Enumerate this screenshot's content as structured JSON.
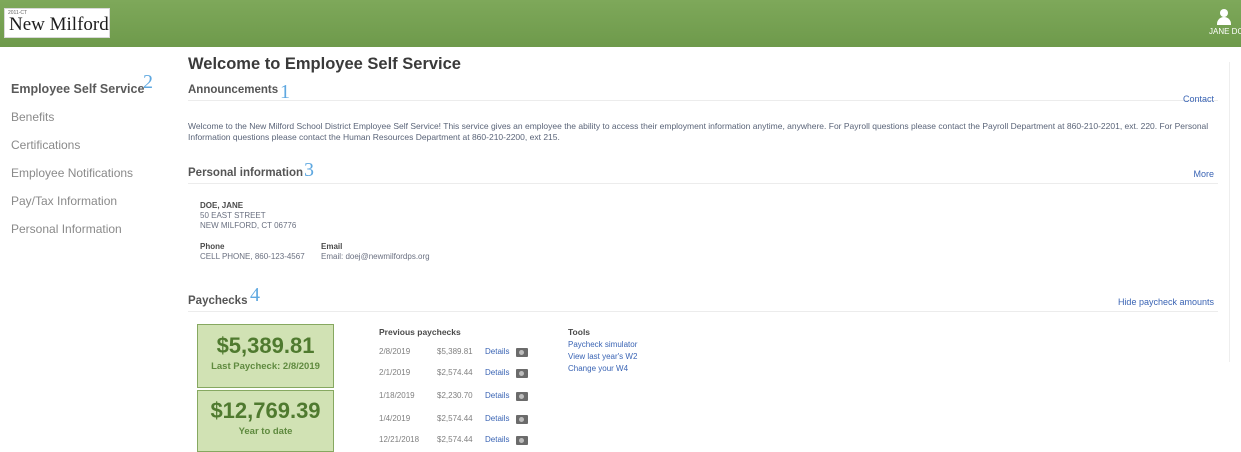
{
  "header": {
    "logo_small": "2011-CT",
    "logo_text": "New Milford",
    "user_name": "JANE DO"
  },
  "sidebar": {
    "items": [
      {
        "label": "Employee Self Service",
        "active": true
      },
      {
        "label": "Benefits"
      },
      {
        "label": "Certifications"
      },
      {
        "label": "Employee Notifications"
      },
      {
        "label": "Pay/Tax Information"
      },
      {
        "label": "Personal Information"
      }
    ]
  },
  "annotations": {
    "a1": "1",
    "a2": "2",
    "a3": "3",
    "a4": "4"
  },
  "main": {
    "title": "Welcome to Employee Self Service",
    "announcements": {
      "title": "Announcements",
      "link": "Contact",
      "text": "Welcome to the New Milford School District Employee Self Service! This service gives an employee the ability to access their employment information anytime, anywhere. For Payroll questions please contact the Payroll Department at 860-210-2201, ext. 220. For Personal Information questions please contact the Human Resources Department at 860-210-2200, ext 215."
    },
    "personal": {
      "title": "Personal information",
      "link": "More",
      "name": "DOE, JANE",
      "address1": "50 EAST STREET",
      "address2": "NEW MILFORD, CT 06776",
      "phone_label": "Phone",
      "phone": "CELL PHONE, 860-123-4567",
      "email_label": "Email",
      "email": "Email: doej@newmilfordps.org"
    },
    "paychecks": {
      "title": "Paychecks",
      "link": "Hide paycheck amounts",
      "last_amount": "$5,389.81",
      "last_label": "Last Paycheck: 2/8/2019",
      "ytd_amount": "$12,769.39",
      "ytd_label": "Year to date",
      "previous_label": "Previous paychecks",
      "details_label": "Details",
      "previous": [
        {
          "date": "2/8/2019",
          "amount": "$5,389.81"
        },
        {
          "date": "2/1/2019",
          "amount": "$2,574.44"
        },
        {
          "date": "1/18/2019",
          "amount": "$2,230.70"
        },
        {
          "date": "1/4/2019",
          "amount": "$2,574.44"
        },
        {
          "date": "12/21/2018",
          "amount": "$2,574.44"
        }
      ],
      "tools_label": "Tools",
      "tools": [
        "Paycheck simulator",
        "View last year's W2",
        "Change your W4"
      ]
    }
  },
  "colors": {
    "header_green": "#6e9a4b",
    "box_green": "#d1e2b4",
    "link_blue": "#3a64b4",
    "annotation_blue": "#5fa8e0"
  }
}
